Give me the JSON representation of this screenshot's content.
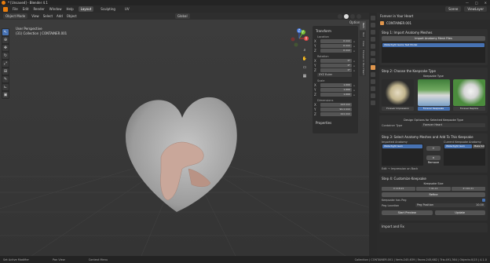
{
  "window": {
    "title": "* [Unsaved] - Blender 4.1",
    "controls": [
      "—",
      "□",
      "✕"
    ]
  },
  "menu": {
    "items": [
      "File",
      "Edit",
      "Render",
      "Window",
      "Help"
    ],
    "workspaces": [
      "Layout",
      "Sculpting",
      "UV"
    ],
    "active_workspace": "Layout",
    "scene": "Scene",
    "view_layer": "ViewLayer"
  },
  "viewport_header": {
    "mode": "Object Mode",
    "menus": [
      "View",
      "Select",
      "Add",
      "Object"
    ],
    "orientation": "Global"
  },
  "viewport": {
    "line1": "User Perspective",
    "line2": "(31) Collection | CONTAINER.001",
    "options": "Options"
  },
  "gizmo": {
    "x": "X",
    "y": "Y",
    "z": "Z"
  },
  "npanel": {
    "title": "Transform",
    "location_label": "Location",
    "location": [
      "0 mm",
      "0 mm",
      "0 mm"
    ],
    "rotation_label": "Rotation",
    "rotation": [
      "0°",
      "0°",
      "0°"
    ],
    "rotation_mode": "XYZ Euler",
    "scale_label": "Scale",
    "scale": [
      "1.000",
      "1.000",
      "1.000"
    ],
    "dimensions_label": "Dimensions",
    "dimensions": [
      "113 mm",
      "91.1 mm",
      "111 mm"
    ],
    "properties": "Properties",
    "axes": [
      "X",
      "Y",
      "Z"
    ],
    "tabs": [
      "Item",
      "Tool",
      "View",
      "Forever in Your Heart"
    ]
  },
  "right_panel": {
    "header": "Forever in Your Heart",
    "object": "CONTAINER.001",
    "step1": {
      "title": "Step 1: Import Anatomy Meshes",
      "button": "Import Anatomy Mesh Files",
      "list_item": "Watertight Gems Test Model"
    },
    "step2": {
      "title": "Step 2: Choose the Keepsake Type",
      "caption": "Keepsake Type",
      "options": [
        "Forever Impression",
        "Forever Keepsake",
        "Forever Replica"
      ],
      "selected": 1
    },
    "design": {
      "title": "Design Options for Selected Keepsake Type",
      "container_label": "Container Type",
      "container_value": "Forever Heart"
    },
    "step3": {
      "title": "Step 3: Select Anatomy Meshes and Add To This Keepsake",
      "imported_label": "Imported Anatomy",
      "current_label": "Current Keepsake Anatomy",
      "imported_item": "Watertight Gem",
      "current_item": "Watertight Gem",
      "add_button": "+",
      "remove_button": "× Remove",
      "make_solid": "Make Sol",
      "note": "Edit → Impression on Back"
    },
    "step4": {
      "title": "Step 4: Customize Keepsake",
      "size_label": "Keepsake Size",
      "size": [
        "118.21",
        "91.11",
        "110.21"
      ],
      "size_axes": [
        "X",
        "Y",
        "Z"
      ],
      "button": "Refine",
      "has_peg": "Keepsake has Peg",
      "peg_location": "Peg Location",
      "peg_position_label": "Peg Position",
      "peg_position_value": "10.00",
      "start_preview": "Start Preview",
      "update": "Update"
    },
    "footer": "Import and Fix"
  },
  "status": {
    "left": "Set Active Modifier",
    "mid1": "Pan View",
    "mid2": "Context Menu",
    "right": "Collection | CONTAINER.001 | Verts:245,639 | Faces:245,682 | Tris:491,364 | Objects:0/15 | 4.1.0"
  }
}
